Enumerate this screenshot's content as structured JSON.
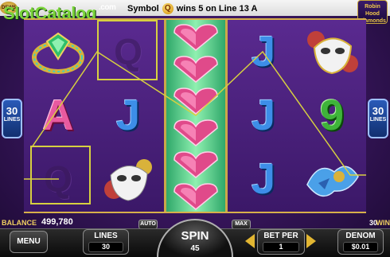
{
  "header": {
    "watermark": "SlotCatalog",
    "watermark_domain": ".com",
    "message_prefix": "Symbol",
    "message_symbol": "Q",
    "message_suffix": "wins 5 on Line 13 A",
    "logo_left": "DEWS",
    "logo_right_lines": [
      "Robin",
      "Hood",
      "Diamonds"
    ]
  },
  "reels": {
    "col1": [
      "bracelet",
      "Q",
      "A",
      "Q"
    ],
    "col2": [
      "Q",
      "J",
      "mask"
    ],
    "col3": [
      "heart",
      "heart",
      "heart",
      "heart",
      "heart",
      "heart"
    ],
    "col4": [
      "J",
      "J",
      "J"
    ],
    "col5": [
      "mask",
      "9",
      "bird"
    ]
  },
  "symbols": {
    "J": "J",
    "A": "A",
    "Q": "Q",
    "nine": "9"
  },
  "side_lines": {
    "count": "30",
    "label": "LINES"
  },
  "status": {
    "balance_label": "BALANCE",
    "balance_value": "499,780",
    "win_value": "30",
    "win_label": "WIN",
    "auto_label": "AUTO",
    "max_label": "MAX"
  },
  "controls": {
    "menu_label": "MENU",
    "lines_label": "LINES",
    "lines_value": "30",
    "spin_label": "SPIN",
    "spin_value": "45",
    "bet_per_label": "BET PER",
    "bet_per_value": "1",
    "denom_label": "DENOM",
    "denom_value": "$0.01"
  },
  "colors": {
    "payline": "#d7d040",
    "frame_gold": "#d7b04a",
    "bg_purple": "#3a1760"
  }
}
